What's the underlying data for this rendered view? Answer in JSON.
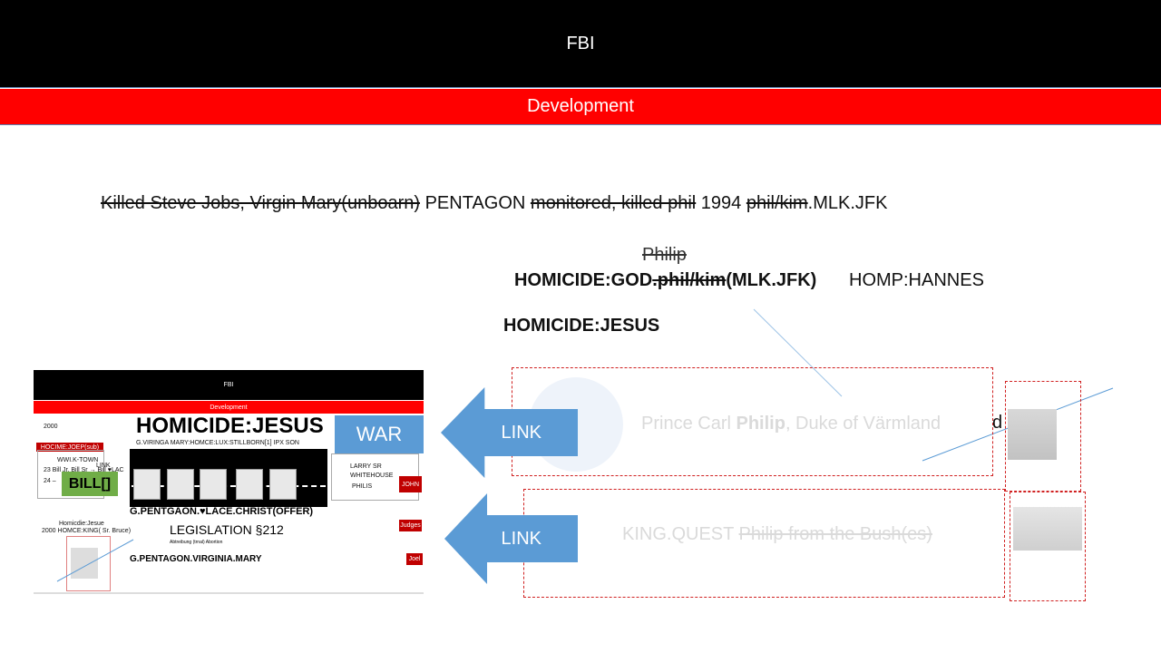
{
  "header": {
    "title": "FBI",
    "subtitle": "Development"
  },
  "line1": {
    "part1": "Killed Steve Jobs, Virgin Mary(unboarn)",
    "part2": " PENTAGON ",
    "part3": "monitored, killed phil",
    "part4": " 1994 ",
    "part5": "phil/kim",
    "part6": ".MLK.JFK"
  },
  "philip": "Philip",
  "homicide_god": {
    "a": "HOMICIDE:GOD",
    "b": ".phil/kim",
    "c": "(MLK.JFK)"
  },
  "homp": "HOMP:HANNES",
  "homicide_jesus": "HOMICIDE:JESUS",
  "links": {
    "link1": "LINK",
    "link2": "LINK"
  },
  "card1": {
    "prefix": "Prince Carl ",
    "bold": "Philip",
    "suffix": ", Duke of Värmland",
    "trail": "d"
  },
  "card2": {
    "prefix": "KING.QUEST ",
    "strike": "Philip from the Bush(es)"
  },
  "thumb": {
    "title": "FBI",
    "subtitle": "Development",
    "year": "2000",
    "headline": "HOMICIDE:JESUS",
    "sub": "G.VIRINGA MARY:HOMCE:LUX:STILLBORN[1] IPX SON",
    "war": "WAR",
    "hocime": "HOCIME:JOEP(sub)",
    "wwi": "WWI.K-TOWN",
    "link_small": "LINK",
    "bills": "23 Bill Jr, Bill Sr → Bill ♥LAC",
    "bill_num": "24 –",
    "bill": "BILL[]",
    "larry1": "LARRY SR",
    "larry2": "WHITEHOUSE",
    "larry3": "PHILIS",
    "john": "JOHN",
    "pentagon1": "G.PENTGAON.♥LACE.CHRIST(OFFER)",
    "homjesue": "Homicdie:Jesue",
    "homking": "2000 HOMCE:KING( Sr. Bruce)",
    "legislation": "LEGISLATION §212",
    "abtreibung": "Abtreibung (trnal) Abortion",
    "pentagon2": "G.PENTAGON.VIRGINIA.MARY",
    "judges": "Judges",
    "joel": "Joel"
  }
}
